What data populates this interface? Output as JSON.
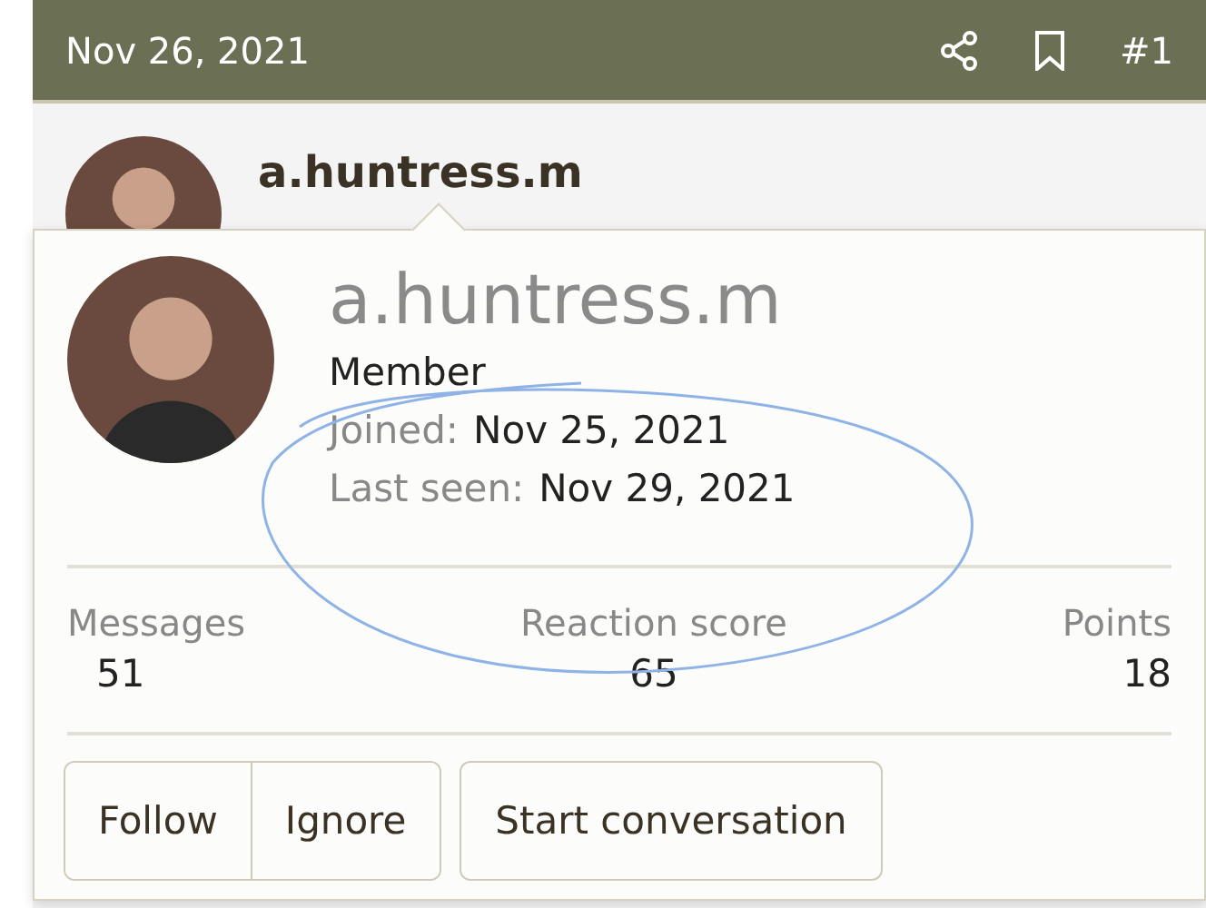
{
  "post_header": {
    "date": "Nov 26, 2021",
    "number": "#1"
  },
  "post_author": {
    "name": "a.huntress.m"
  },
  "member_card": {
    "name": "a.huntress.m",
    "title": "Member",
    "details": [
      {
        "label": "Joined:",
        "value": "Nov 25, 2021"
      },
      {
        "label": "Last seen:",
        "value": "Nov 29, 2021"
      }
    ],
    "stats": [
      {
        "label": "Messages",
        "value": "51"
      },
      {
        "label": "Reaction score",
        "value": "65"
      },
      {
        "label": "Points",
        "value": "18"
      }
    ],
    "button_group": [
      "Follow",
      "Ignore"
    ],
    "buttons": [
      "Start conversation"
    ]
  }
}
